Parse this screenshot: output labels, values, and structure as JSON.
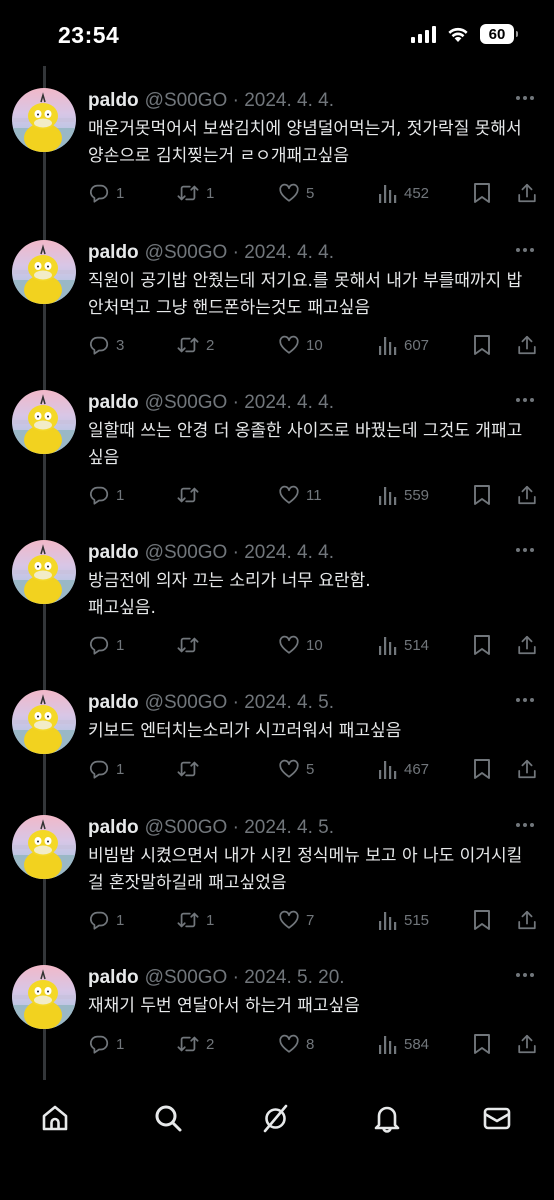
{
  "status_bar": {
    "time": "23:54",
    "battery": "60"
  },
  "tweets": [
    {
      "name": "paldo",
      "handle_date": "@S00GO · 2024. 4. 4.",
      "text": "매운거못먹어서 보쌈김치에 양념덜어먹는거, 젓가락질 못해서 양손으로 김치찢는거 ㄹㅇ개패고싶음",
      "replies": "1",
      "reposts": "1",
      "likes": "5",
      "views": "452"
    },
    {
      "name": "paldo",
      "handle_date": "@S00GO · 2024. 4. 4.",
      "text": "직원이 공기밥 안줬는데 저기요.를 못해서 내가 부를때까지 밥 안처먹고 그냥 핸드폰하는것도 패고싶음",
      "replies": "3",
      "reposts": "2",
      "likes": "10",
      "views": "607"
    },
    {
      "name": "paldo",
      "handle_date": "@S00GO · 2024. 4. 4.",
      "text": "일할때 쓰는 안경 더 옹졸한 사이즈로 바꿨는데 그것도 개패고싶음",
      "replies": "1",
      "reposts": "",
      "likes": "11",
      "views": "559"
    },
    {
      "name": "paldo",
      "handle_date": "@S00GO · 2024. 4. 4.",
      "text": "방금전에 의자 끄는 소리가 너무 요란함.\n패고싶음.",
      "replies": "1",
      "reposts": "",
      "likes": "10",
      "views": "514"
    },
    {
      "name": "paldo",
      "handle_date": "@S00GO · 2024. 4. 5.",
      "text": "키보드  엔터치는소리가 시끄러워서 패고싶음",
      "replies": "1",
      "reposts": "",
      "likes": "5",
      "views": "467"
    },
    {
      "name": "paldo",
      "handle_date": "@S00GO · 2024. 4. 5.",
      "text": "비빔밥 시켰으면서 내가 시킨 정식메뉴 보고 아 나도 이거시킬걸 혼잣말하길래 패고싶었음",
      "replies": "1",
      "reposts": "1",
      "likes": "7",
      "views": "515"
    },
    {
      "name": "paldo",
      "handle_date": "@S00GO · 2024. 5. 20.",
      "text": "재채기 두번 연달아서 하는거 패고싶음",
      "replies": "1",
      "reposts": "2",
      "likes": "8",
      "views": "584"
    }
  ],
  "icons": {
    "reply": "reply-icon",
    "repost": "repost-icon",
    "like": "heart-icon",
    "views": "views-icon",
    "bookmark": "bookmark-icon",
    "share": "share-icon",
    "nav": [
      "home-icon",
      "search-icon",
      "grok-icon",
      "notifications-icon",
      "messages-icon"
    ]
  },
  "colors": {
    "background": "#000000",
    "text": "#e7e9ea",
    "muted": "#71767b",
    "avatar_duck": "#f2d21f"
  }
}
